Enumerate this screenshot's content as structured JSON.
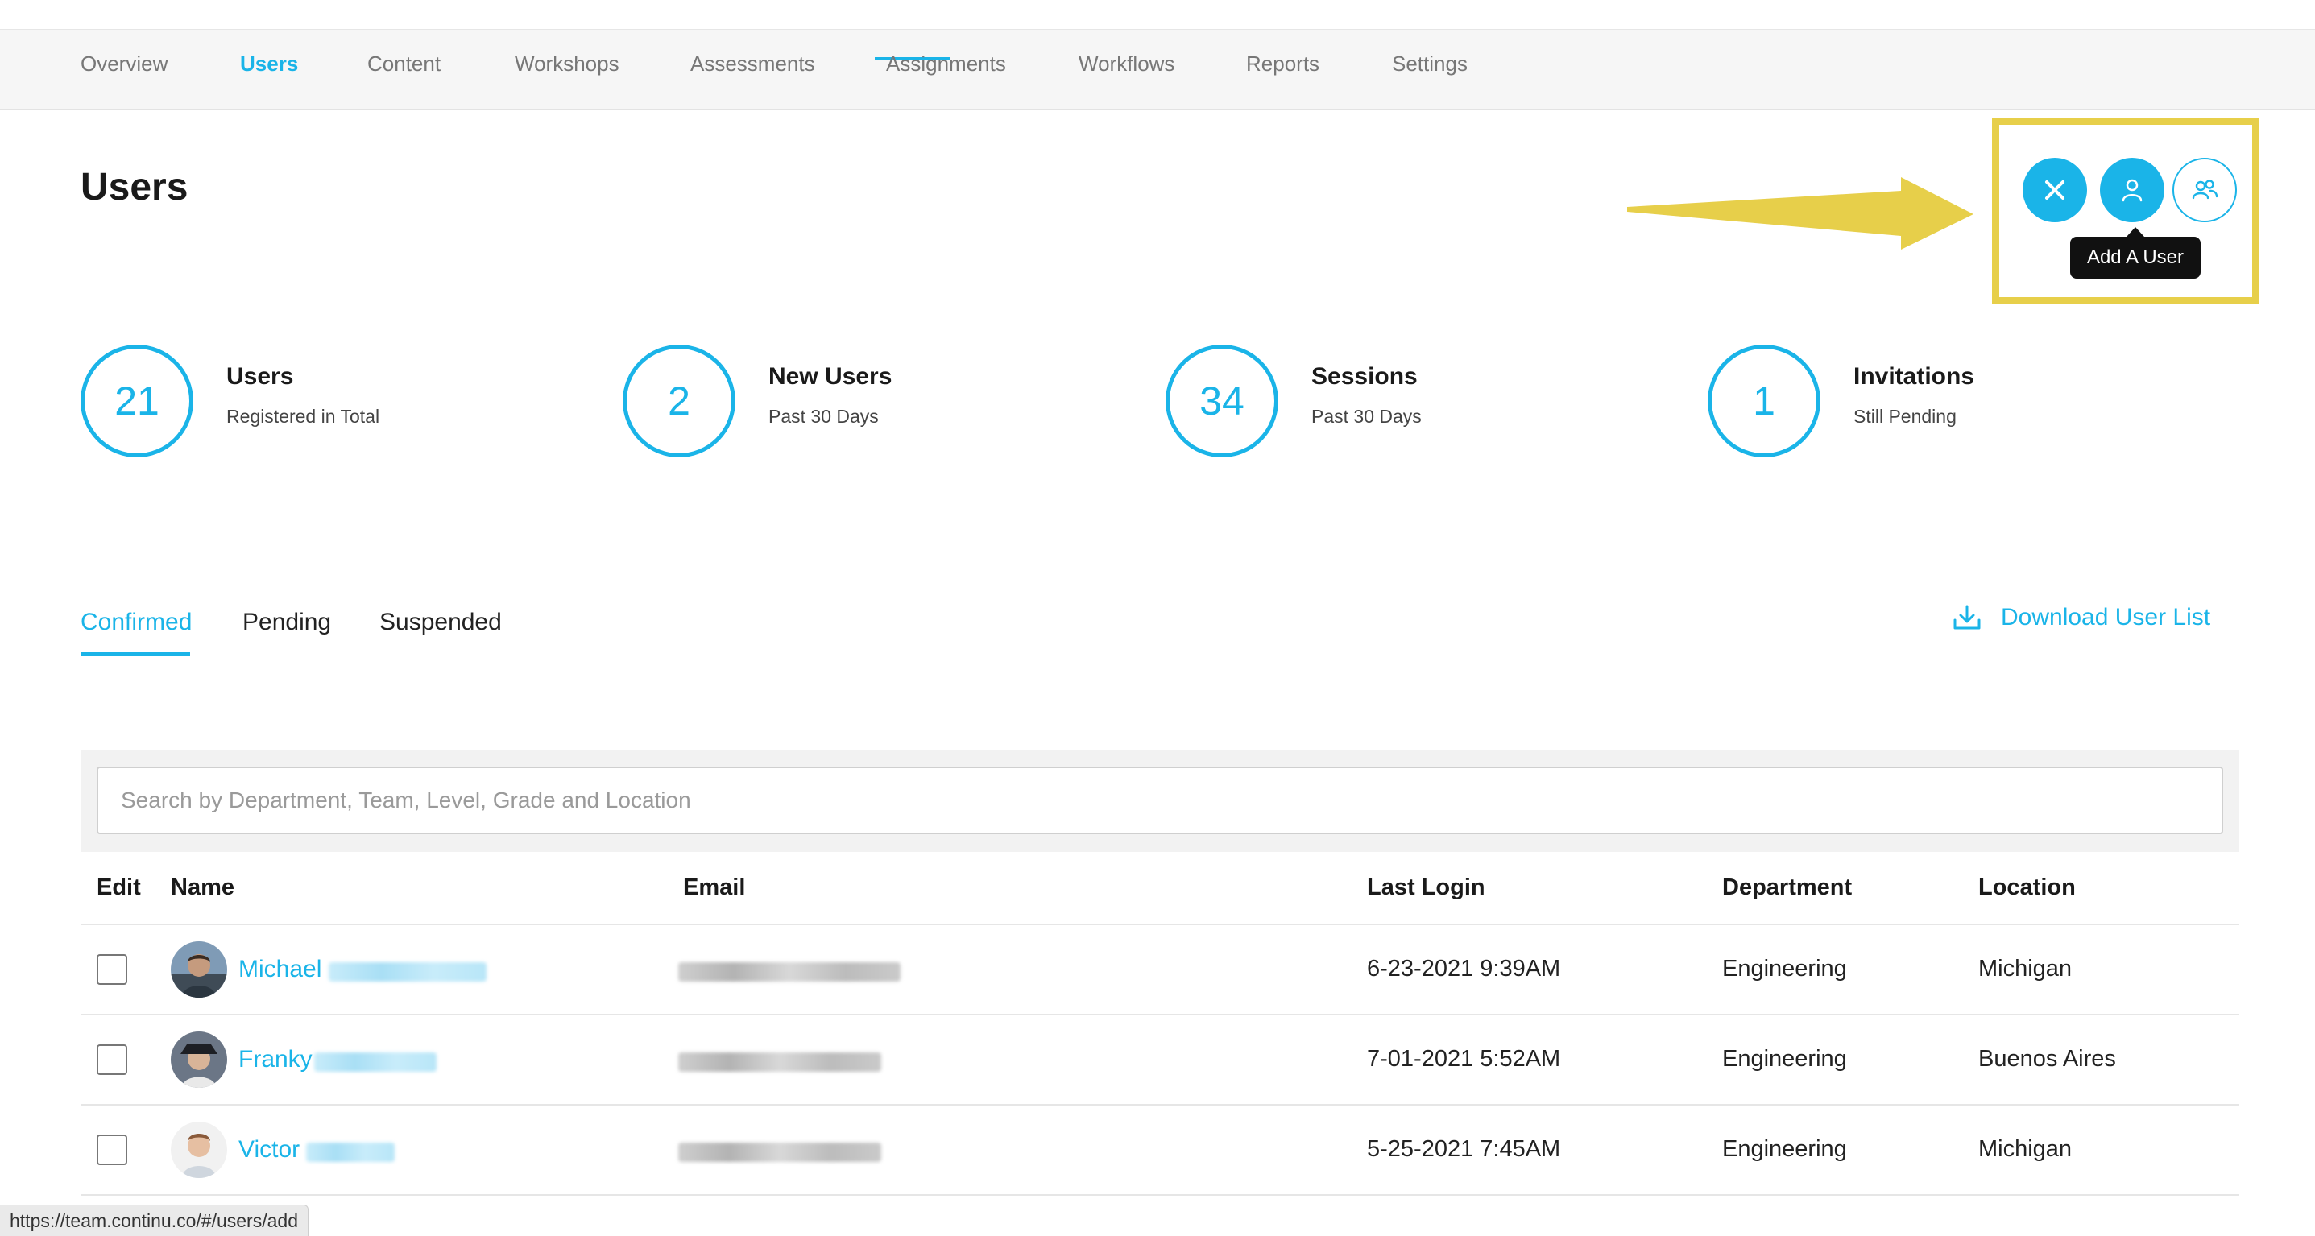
{
  "nav": {
    "items": [
      {
        "label": "Overview"
      },
      {
        "label": "Users"
      },
      {
        "label": "Content"
      },
      {
        "label": "Workshops"
      },
      {
        "label": "Assessments"
      },
      {
        "label": "Assignments"
      },
      {
        "label": "Workflows"
      },
      {
        "label": "Reports"
      },
      {
        "label": "Settings"
      }
    ],
    "active": "Users"
  },
  "page": {
    "title": "Users"
  },
  "actions": {
    "close_icon": "close-icon",
    "add_user_icon": "user-icon",
    "add_group_icon": "users-group-icon",
    "tooltip": "Add A User",
    "highlight_color": "#e7cf4a"
  },
  "stats": [
    {
      "value": "21",
      "title": "Users",
      "subtitle": "Registered in Total"
    },
    {
      "value": "2",
      "title": "New Users",
      "subtitle": "Past 30 Days"
    },
    {
      "value": "34",
      "title": "Sessions",
      "subtitle": "Past 30 Days"
    },
    {
      "value": "1",
      "title": "Invitations",
      "subtitle": "Still Pending"
    }
  ],
  "tabs": [
    {
      "label": "Confirmed"
    },
    {
      "label": "Pending"
    },
    {
      "label": "Suspended"
    }
  ],
  "download": {
    "label": "Download User List",
    "icon": "download-icon"
  },
  "search": {
    "placeholder": "Search by Department, Team, Level, Grade and Location",
    "value": ""
  },
  "table": {
    "headers": {
      "edit": "Edit",
      "name": "Name",
      "email": "Email",
      "last_login": "Last Login",
      "department": "Department",
      "location": "Location"
    },
    "rows": [
      {
        "first_name": "Michael",
        "last_login": "6-23-2021 9:39AM",
        "department": "Engineering",
        "location": "Michigan"
      },
      {
        "first_name": "Franky",
        "last_login": "7-01-2021 5:52AM",
        "department": "Engineering",
        "location": "Buenos Aires"
      },
      {
        "first_name": "Victor",
        "last_login": "5-25-2021 7:45AM",
        "department": "Engineering",
        "location": "Michigan"
      }
    ]
  },
  "statusbar": {
    "url": "https://team.continu.co/#/users/add"
  },
  "colors": {
    "accent": "#1ab4e8",
    "nav_bg": "#f6f6f6"
  }
}
